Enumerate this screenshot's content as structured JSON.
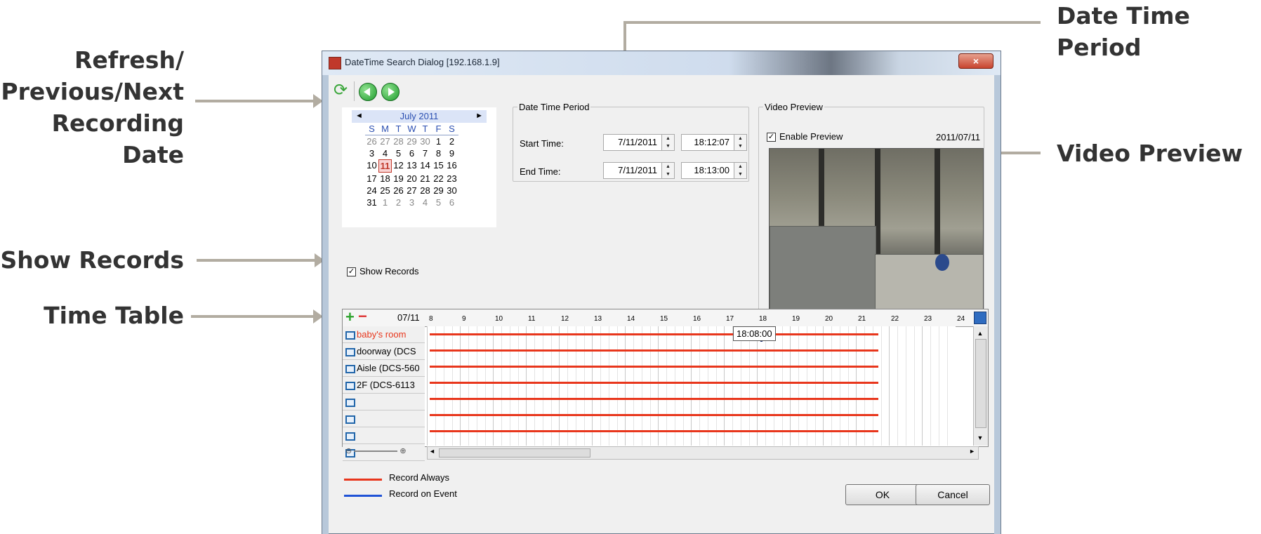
{
  "callouts": {
    "refresh_line1": "Refresh/",
    "refresh_line2": "Previous/Next",
    "refresh_line3": "Recording Date",
    "show_records": "Show Records",
    "time_table": "Time Table",
    "date_time_period": "Date Time Period",
    "video_preview": "Video Preview"
  },
  "window": {
    "title": "DateTime Search Dialog  [192.168.1.9]",
    "close_glyph": "×"
  },
  "calendar": {
    "month_label": "July 2011",
    "prev_glyph": "◄",
    "next_glyph": "►",
    "weekdays": [
      "S",
      "M",
      "T",
      "W",
      "T",
      "F",
      "S"
    ],
    "weeks": [
      [
        "26",
        "27",
        "28",
        "29",
        "30",
        "1",
        "2"
      ],
      [
        "3",
        "4",
        "5",
        "6",
        "7",
        "8",
        "9"
      ],
      [
        "10",
        "11",
        "12",
        "13",
        "14",
        "15",
        "16"
      ],
      [
        "17",
        "18",
        "19",
        "20",
        "21",
        "22",
        "23"
      ],
      [
        "24",
        "25",
        "26",
        "27",
        "28",
        "29",
        "30"
      ],
      [
        "31",
        "1",
        "2",
        "3",
        "4",
        "5",
        "6"
      ]
    ],
    "selected_day": "11"
  },
  "show_records": {
    "label": "Show Records",
    "checked": true
  },
  "date_time_period": {
    "legend": "Date Time Period",
    "start_label": "Start Time:",
    "start_date": "7/11/2011",
    "start_time": "18:12:07",
    "end_label": "End Time:",
    "end_date": "7/11/2011",
    "end_time": "18:13:00"
  },
  "video_preview": {
    "legend": "Video Preview",
    "enable_label": "Enable Preview",
    "enabled": true,
    "date": "2011/07/11"
  },
  "time_table": {
    "date": "07/11",
    "hours": [
      "8",
      "9",
      "10",
      "11",
      "12",
      "13",
      "14",
      "15",
      "16",
      "17",
      "18",
      "19",
      "20",
      "21",
      "22",
      "23",
      "24"
    ],
    "channels": [
      {
        "name": "baby's room",
        "highlight": true
      },
      {
        "name": "doorway (DCS",
        "highlight": false
      },
      {
        "name": "Aisle (DCS-560",
        "highlight": false
      },
      {
        "name": "2F (DCS-6113",
        "highlight": false
      },
      {
        "name": "",
        "highlight": false
      },
      {
        "name": "",
        "highlight": false
      },
      {
        "name": "",
        "highlight": false
      },
      {
        "name": "",
        "highlight": false
      }
    ],
    "tooltip": "18:08:00",
    "record_end_hour": 21.6
  },
  "legend": {
    "record_always": "Record Always",
    "record_on_event": "Record on Event",
    "record_always_color": "#e8361c",
    "record_on_event_color": "#1f52d6"
  },
  "buttons": {
    "ok": "OK",
    "cancel": "Cancel"
  }
}
